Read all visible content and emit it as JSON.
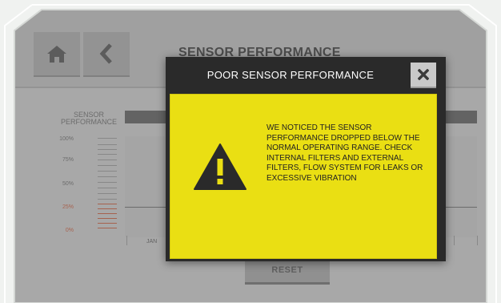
{
  "app": {
    "title": "SENSOR PERFORMANCE"
  },
  "nav": {
    "home_icon": "home-icon",
    "back_icon": "chevron-left-icon"
  },
  "gauge": {
    "label_line1": "SENSOR",
    "label_line2": "PERFORMANCE",
    "ticks": [
      "100%",
      "75%",
      "50%",
      "25%",
      "0%"
    ]
  },
  "chart": {
    "months": [
      "JAN"
    ]
  },
  "buttons": {
    "reset_label": "RESET"
  },
  "modal": {
    "title": "POOR SENSOR PERFORMANCE",
    "close_icon": "close-icon",
    "warning_icon": "warning-triangle-icon",
    "message": "WE NOTICED THE SENSOR PERFORMANCE DROPPED BELOW THE NORMAL OPERATING RANGE. CHECK INTERNAL FILTERS AND EXTERNAL FILTERS, FLOW SYSTEM FOR LEAKS OR EXCESSIVE VIBRATION"
  },
  "colors": {
    "modal_bg": "#2a2a2a",
    "warning_yellow": "#eadf13",
    "accent_green": "#18b54a",
    "low_range_red": "#e7795a"
  }
}
